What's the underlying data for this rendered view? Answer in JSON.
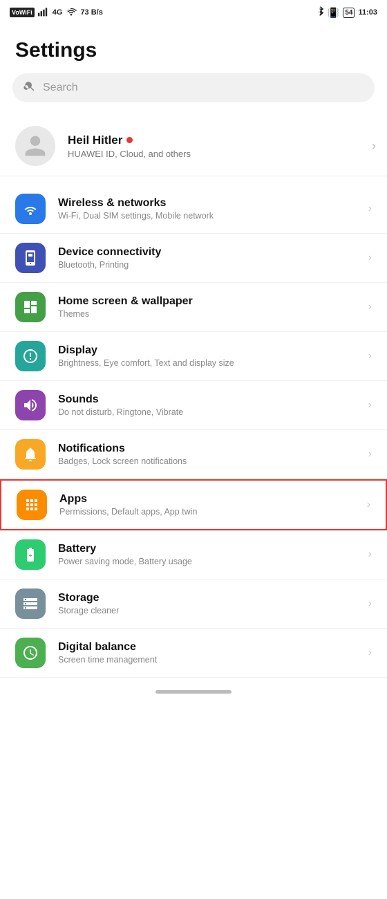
{
  "statusBar": {
    "left": {
      "wifiLabel": "VoWiFi",
      "signal": "4G",
      "bars": "|||",
      "wifiIcon": "wifi",
      "speed": "73 B/s"
    },
    "right": {
      "bluetooth": "⚡",
      "battery": "54",
      "time": "11:03"
    }
  },
  "pageTitle": "Settings",
  "search": {
    "placeholder": "Search"
  },
  "userProfile": {
    "name": "Heil Hitler",
    "nameDot": true,
    "subtitle": "HUAWEI ID, Cloud, and others"
  },
  "settingsItems": [
    {
      "id": "wireless",
      "title": "Wireless & networks",
      "subtitle": "Wi-Fi, Dual SIM settings, Mobile network",
      "iconColor": "bg-blue",
      "iconType": "wifi"
    },
    {
      "id": "device",
      "title": "Device connectivity",
      "subtitle": "Bluetooth, Printing",
      "iconColor": "bg-indigo",
      "iconType": "device"
    },
    {
      "id": "homescreen",
      "title": "Home screen & wallpaper",
      "subtitle": "Themes",
      "iconColor": "bg-green",
      "iconType": "homescreen"
    },
    {
      "id": "display",
      "title": "Display",
      "subtitle": "Brightness, Eye comfort, Text and display size",
      "iconColor": "bg-teal",
      "iconType": "display"
    },
    {
      "id": "sounds",
      "title": "Sounds",
      "subtitle": "Do not disturb, Ringtone, Vibrate",
      "iconColor": "bg-purple",
      "iconType": "sounds"
    },
    {
      "id": "notifications",
      "title": "Notifications",
      "subtitle": "Badges, Lock screen notifications",
      "iconColor": "bg-amber",
      "iconType": "notifications"
    },
    {
      "id": "apps",
      "title": "Apps",
      "subtitle": "Permissions, Default apps, App twin",
      "iconColor": "bg-orange",
      "iconType": "apps",
      "highlighted": true
    },
    {
      "id": "battery",
      "title": "Battery",
      "subtitle": "Power saving mode, Battery usage",
      "iconColor": "bg-battery-green",
      "iconType": "battery"
    },
    {
      "id": "storage",
      "title": "Storage",
      "subtitle": "Storage cleaner",
      "iconColor": "bg-storage-gray",
      "iconType": "storage"
    },
    {
      "id": "digitalbalance",
      "title": "Digital balance",
      "subtitle": "Screen time management",
      "iconColor": "bg-screen-green",
      "iconType": "digitalbalance"
    }
  ]
}
